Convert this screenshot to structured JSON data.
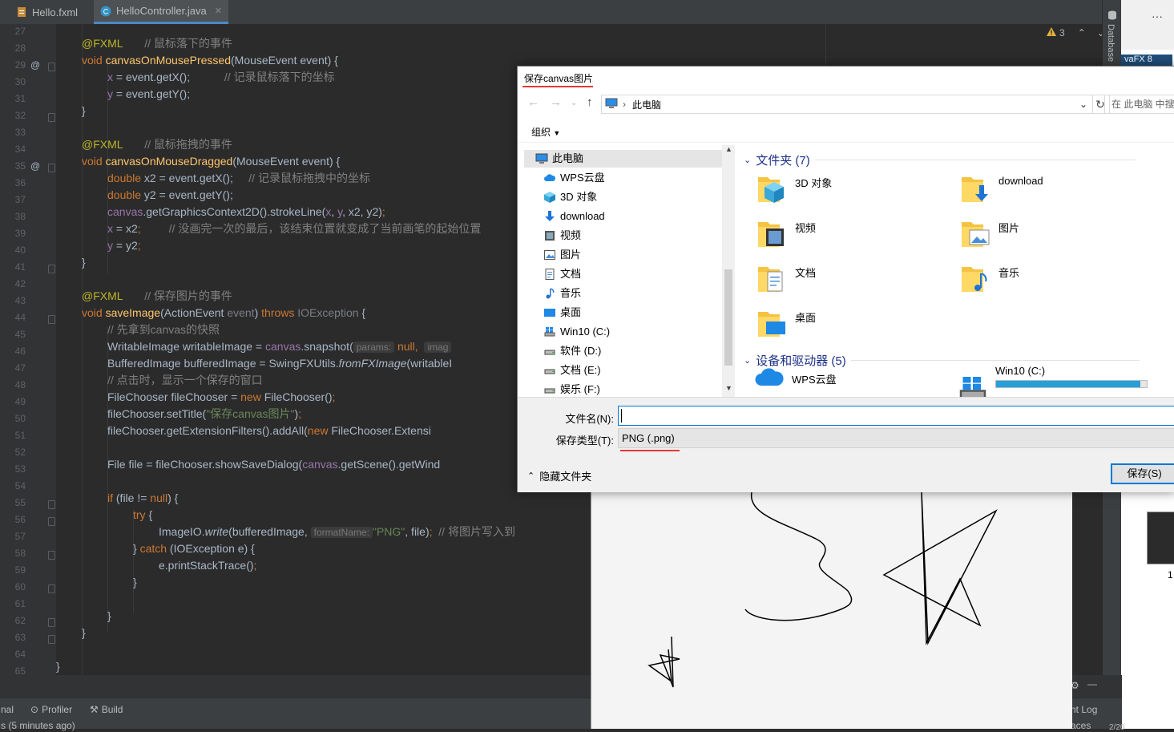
{
  "ide": {
    "tabs": [
      {
        "label": "Hello.fxml",
        "active": false
      },
      {
        "label": "HelloController.java",
        "active": true
      }
    ],
    "line_numbers": [
      "27",
      "28",
      "29",
      "30",
      "31",
      "32",
      "33",
      "34",
      "35",
      "36",
      "37",
      "38",
      "39",
      "40",
      "41",
      "42",
      "43",
      "44",
      "45",
      "46",
      "47",
      "48",
      "49",
      "50",
      "51",
      "52",
      "53",
      "54",
      "55",
      "56",
      "57",
      "58",
      "59",
      "60",
      "61",
      "62",
      "63",
      "64",
      "65"
    ],
    "annotation_marker": "@",
    "inspection": {
      "warning_count": "3"
    },
    "database_label": "Database",
    "ext_window_text": "vaFX 8",
    "ext_window_number": "1",
    "code": {
      "l28_an": "@FXML",
      "l28_c": "// 鼠标落下的事件",
      "l29_mod": "void",
      "l29_fn": "canvasOnMousePressed",
      "l29_rest": "(MouseEvent event) {",
      "l30_x": "x",
      "l30_rest": " = event.getX();",
      "l30_c": "// 记录鼠标落下的坐标",
      "l31_y": "y",
      "l31_rest": " = event.getY();",
      "l32": "}",
      "l34_an": "@FXML",
      "l34_c": "// 鼠标拖拽的事件",
      "l35_mod": "void",
      "l35_fn": "canvasOnMouseDragged",
      "l35_rest": "(MouseEvent event) {",
      "l36_k": "double",
      "l36_rest": " x2 = event.getX();",
      "l36_c": "// 记录鼠标拖拽中的坐标",
      "l37_k": "double",
      "l37_rest": " y2 = event.getY();",
      "l38_f": "canvas",
      "l38_a": ".getGraphicsContext2D().strokeLine(",
      "l38_x": "x",
      "l38_b": ", ",
      "l38_y": "y",
      "l38_c": ", x2, y2)",
      "l38_semi": ";",
      "l39_x": "x",
      "l39_rest": " = x2",
      "l39_semi": ";",
      "l39_c": "// 没画完一次的最后，该结束位置就变成了当前画笔的起始位置",
      "l40_y": "y",
      "l40_rest": " = y2",
      "l40_semi": ";",
      "l41": "}",
      "l43_an": "@FXML",
      "l43_c": "// 保存图片的事件",
      "l44_mod": "void",
      "l44_fn": "saveImage",
      "l44_a": "(ActionEvent ",
      "l44_p": "event",
      "l44_b": ") ",
      "l44_throws": "throws",
      "l44_exc": "IOException",
      "l44_end": " {",
      "l45_c": "// 先拿到canvas的快照",
      "l46_a": "WritableImage writableImage = ",
      "l46_f": "canvas",
      "l46_b": ".snapshot(",
      "l46_hint": "params:",
      "l46_null": "null",
      "l46_c": ",",
      "l46_hint2": "imag",
      "l47_a": "BufferedImage bufferedImage = SwingFXUtils.",
      "l47_it": "fromFXImage",
      "l47_b": "(writableI",
      "l48_c": "// 点击时，显示一个保存的窗口",
      "l49_a": "FileChooser fileChooser = ",
      "l49_new": "new",
      "l49_b": " FileChooser()",
      "l49_semi": ";",
      "l50_a": "fileChooser.setTitle(",
      "l50_s": "\"保存canvas图片\"",
      "l50_b": ")",
      "l50_semi": ";",
      "l51_a": "fileChooser.getExtensionFilters().addAll(",
      "l51_new": "new",
      "l51_b": " FileChooser.Extensi",
      "l53_a": "File file = fileChooser.showSaveDialog(",
      "l53_f": "canvas",
      "l53_b": ".getScene().getWind",
      "l55_if": "if",
      "l55_a": " (file != ",
      "l55_null": "null",
      "l55_b": ") {",
      "l56_try": "try",
      "l56_b": " {",
      "l57_a": "ImageIO.",
      "l57_it": "write",
      "l57_b": "(bufferedImage,",
      "l57_hint": "formatName:",
      "l57_s": "\"PNG\"",
      "l57_c": ", file)",
      "l57_semi": ";",
      "l57_cm": "// 将图片写入到",
      "l58_a": "} ",
      "l58_catch": "catch",
      "l58_b": " (IOException e) {",
      "l59_a": "e.printStackTrace()",
      "l59_semi": ";",
      "l60": "}",
      "l62": "}",
      "l63": "}",
      "l65": "}"
    },
    "status": {
      "terminal": "nal",
      "profiler": "Profiler",
      "build": "Build",
      "time": "s (5 minutes ago)",
      "event_log": "nt Log",
      "right_bottom": "aces",
      "right_bottom_num": "2/20"
    }
  },
  "dialog": {
    "title": "保存canvas图片",
    "address": {
      "breadcrumb": "此电脑"
    },
    "search_placeholder": "在 此电脑 中搜",
    "organize": "组织",
    "nav_items": [
      {
        "label": "此电脑",
        "icon": "pc-icon",
        "selected": true
      },
      {
        "label": "WPS云盘",
        "icon": "cloud-icon"
      },
      {
        "label": "3D 对象",
        "icon": "cube-icon"
      },
      {
        "label": "download",
        "icon": "download-icon"
      },
      {
        "label": "视频",
        "icon": "video-icon"
      },
      {
        "label": "图片",
        "icon": "picture-icon"
      },
      {
        "label": "文档",
        "icon": "document-icon"
      },
      {
        "label": "音乐",
        "icon": "music-icon"
      },
      {
        "label": "桌面",
        "icon": "desktop-icon"
      },
      {
        "label": "Win10 (C:)",
        "icon": "windows-drive-icon"
      },
      {
        "label": "软件 (D:)",
        "icon": "drive-icon"
      },
      {
        "label": "文档 (E:)",
        "icon": "drive-icon"
      },
      {
        "label": "娱乐 (F:)",
        "icon": "drive-icon"
      }
    ],
    "folders_group": "文件夹 (7)",
    "folders": [
      {
        "label": "3D 对象",
        "icon": "cube-icon"
      },
      {
        "label": "download",
        "icon": "download-icon"
      },
      {
        "label": "视频",
        "icon": "video-icon"
      },
      {
        "label": "图片",
        "icon": "picture-icon"
      },
      {
        "label": "文档",
        "icon": "document-icon"
      },
      {
        "label": "音乐",
        "icon": "music-icon"
      },
      {
        "label": "桌面",
        "icon": "desktop-icon"
      }
    ],
    "devices_group": "设备和驱动器 (5)",
    "devices": [
      {
        "label": "WPS云盘",
        "icon": "cloud-icon"
      },
      {
        "label": "Win10 (C:)",
        "icon": "windows-drive-icon",
        "usage_fraction": 0.96
      }
    ],
    "filename_label": "文件名(N):",
    "filename_value": "",
    "filetype_label": "保存类型(T):",
    "filetype_value": "PNG (.png)",
    "hide_folders": "隐藏文件夹",
    "save_button": "保存(S)"
  },
  "colors": {
    "accent": "#0078d7",
    "highlight_red": "#e53935",
    "folder_title": "#1e3287",
    "ide_bg": "#2b2b2b"
  }
}
